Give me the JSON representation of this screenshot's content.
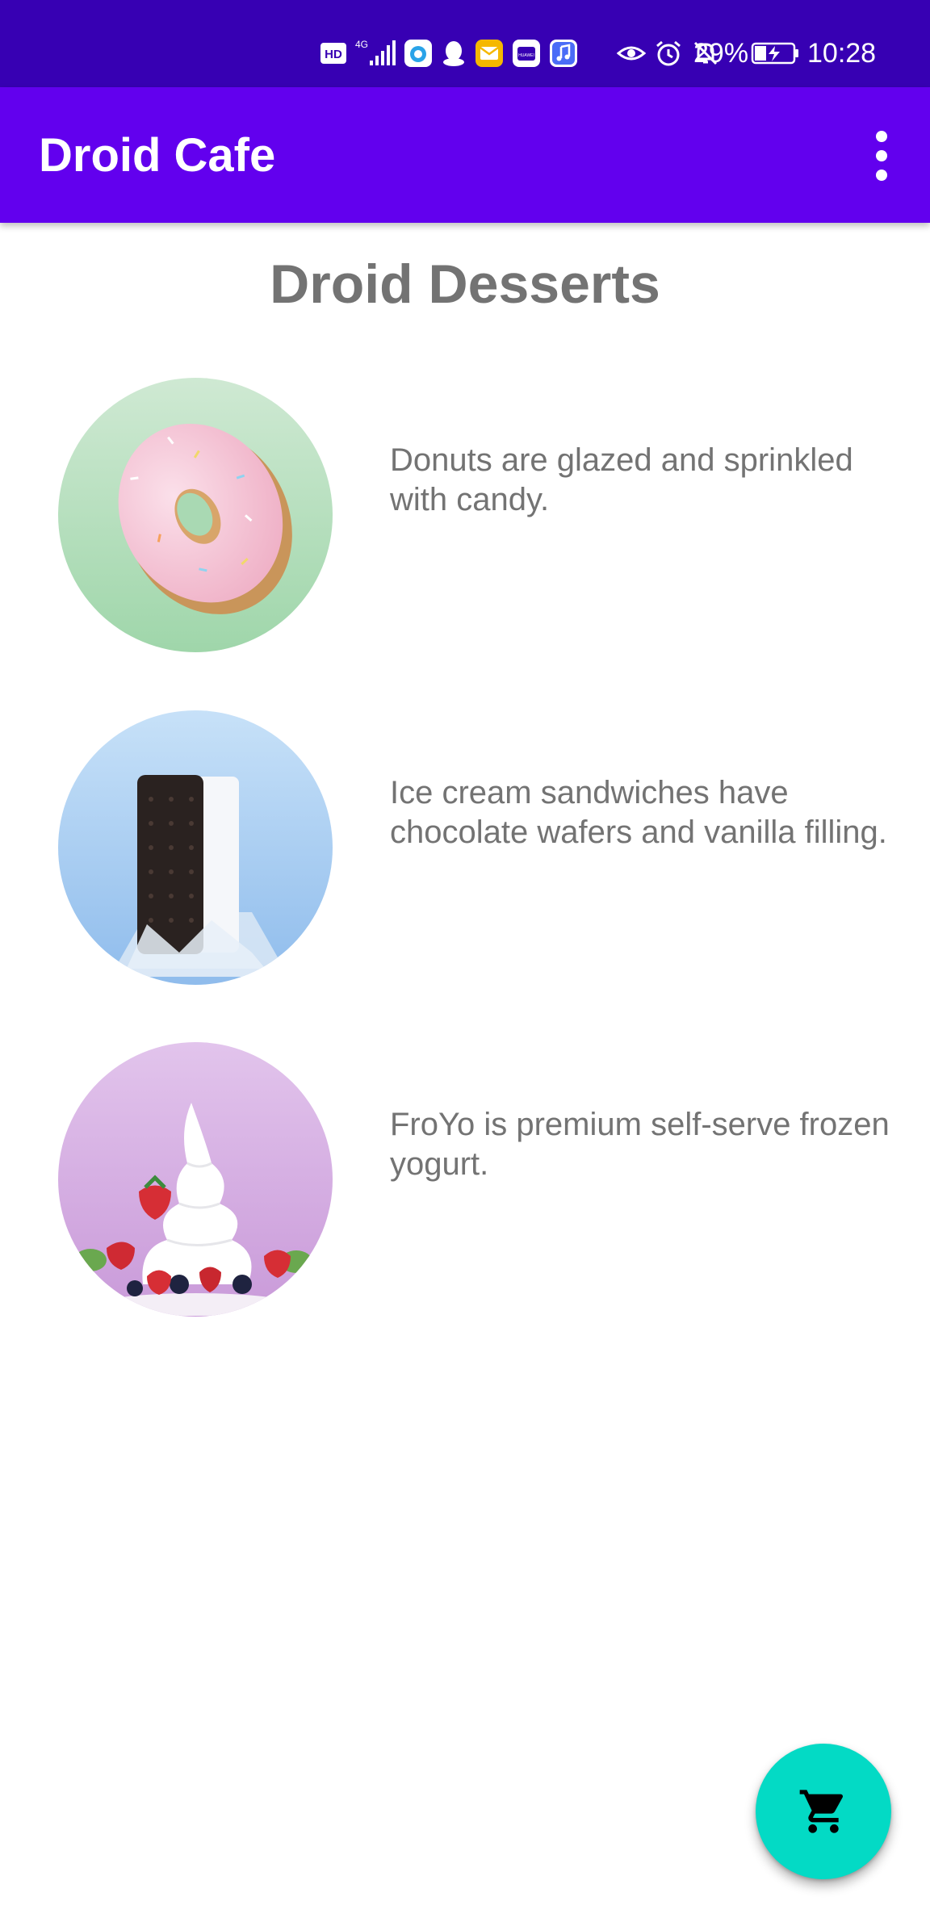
{
  "status_bar": {
    "battery": "29%",
    "time": "10:28",
    "network": "4G",
    "icons": [
      "hd-icon",
      "signal-icon",
      "browser-icon",
      "qq-icon",
      "email-icon",
      "huawei-store-icon",
      "music-icon",
      "eye-icon",
      "alarm-icon",
      "notifications-off-icon",
      "battery-charging-icon"
    ],
    "hd_label": "HD",
    "huawei_label": "HUAWEI"
  },
  "app_bar": {
    "title": "Droid Cafe",
    "menu_icon": "more-vert-icon"
  },
  "content": {
    "heading": "Droid Desserts",
    "items": [
      {
        "image": "donut",
        "description": "Donuts are glazed and sprinkled with candy."
      },
      {
        "image": "ice-cream-sandwich",
        "description": "Ice cream sandwiches have chocolate wafers and vanilla filling."
      },
      {
        "image": "froyo",
        "description": "FroYo is premium self-serve frozen yogurt."
      }
    ]
  },
  "fab": {
    "icon": "shopping-cart-icon"
  },
  "colors": {
    "status_bar": "#3700b3",
    "app_bar": "#6200ee",
    "fab": "#03dac5",
    "text": "#737373"
  }
}
